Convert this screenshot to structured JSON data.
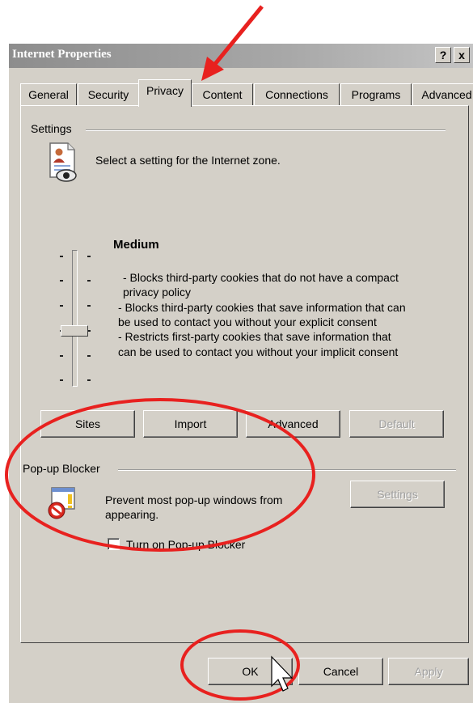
{
  "window": {
    "title": "Internet Properties",
    "help_label": "?",
    "close_label": "x"
  },
  "tabs": [
    {
      "label": "General",
      "active": false
    },
    {
      "label": "Security",
      "active": false
    },
    {
      "label": "Privacy",
      "active": true
    },
    {
      "label": "Content",
      "active": false
    },
    {
      "label": "Connections",
      "active": false
    },
    {
      "label": "Programs",
      "active": false
    },
    {
      "label": "Advanced",
      "active": false
    }
  ],
  "settings": {
    "group_label": "Settings",
    "description": "Select a setting for the Internet zone.",
    "level_name": "Medium",
    "level_value": "Medium",
    "level_lines": [
      "- Blocks third-party cookies that do not have a compact",
      "privacy policy",
      "- Blocks third-party cookies that save information that can",
      "be used to contact you without your explicit consent",
      "- Restricts first-party cookies that save information that",
      "can be used to contact you without your implicit consent"
    ],
    "buttons": {
      "sites": "Sites",
      "import": "Import",
      "advanced": "Advanced",
      "default": "Default"
    }
  },
  "popup_blocker": {
    "group_label": "Pop-up Blocker",
    "description_line1": "Prevent most pop-up windows from",
    "description_line2": "appearing.",
    "checkbox_label": "Turn on Pop-up Blocker",
    "checkbox_checked": false,
    "settings_button": "Settings"
  },
  "footer": {
    "ok": "OK",
    "cancel": "Cancel",
    "apply": "Apply"
  },
  "annotations": {
    "color": "#e8211f"
  },
  "icons": {
    "privacy": "privacy-document-eye-icon",
    "popup": "popup-blocked-icon",
    "cursor": "mouse-pointer-icon"
  }
}
